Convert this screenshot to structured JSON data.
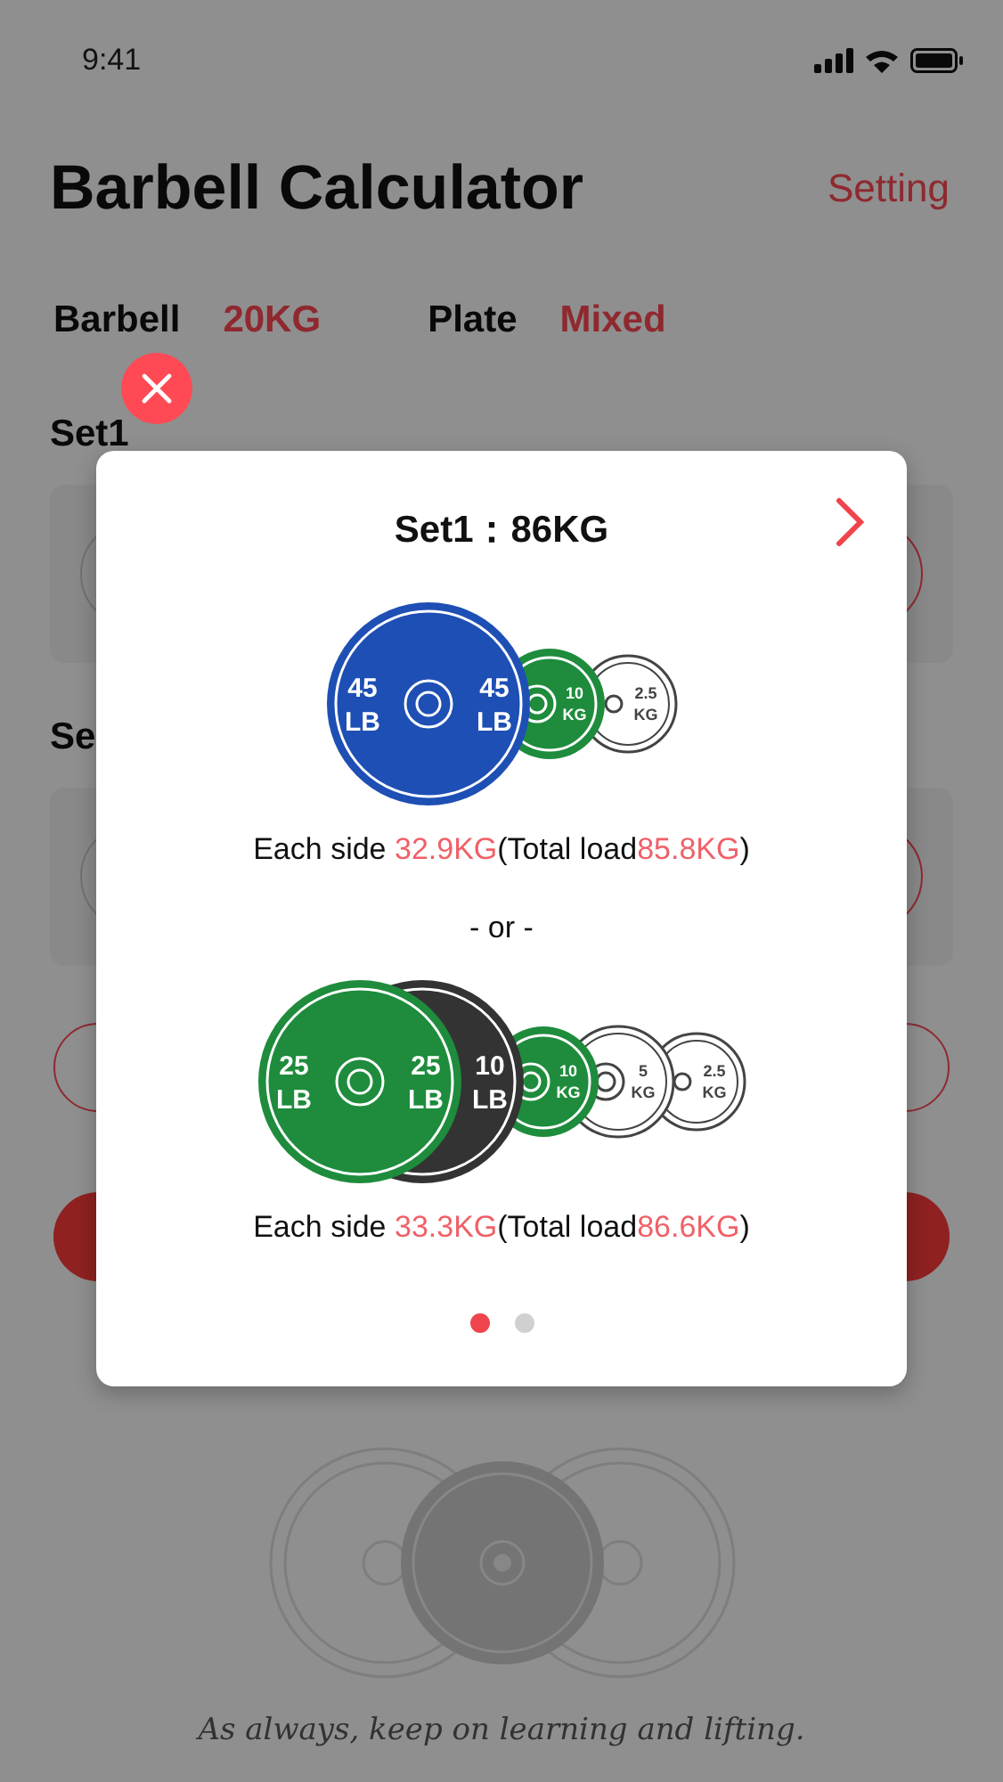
{
  "status_bar": {
    "time": "9:41"
  },
  "header": {
    "title": "Barbell Calculator",
    "action": "Setting"
  },
  "settings": [
    {
      "label": "Barbell",
      "value": "20KG"
    },
    {
      "label": "Plate",
      "value": "Mixed"
    }
  ],
  "sets": [
    {
      "label": "Set1"
    },
    {
      "label": "Se"
    }
  ],
  "tagline": "As always, keep on learning and lifting.",
  "dialog": {
    "title": "Set1：86KG",
    "options": [
      {
        "plates": [
          {
            "kind": "bumper",
            "color": "#1e4fb4",
            "labels": [
              {
                "value": "45",
                "unit": "LB"
              },
              {
                "value": "45",
                "unit": "LB"
              }
            ]
          },
          {
            "kind": "change",
            "color": "#1e8c3c",
            "labels": [
              {
                "value": "10",
                "unit": "KG"
              }
            ]
          },
          {
            "kind": "fractional",
            "color": "#ffffff",
            "labels": [
              {
                "value": "2.5",
                "unit": "KG"
              }
            ]
          }
        ],
        "prefix": "Each side ",
        "each_side": "32.9KG",
        "middle": "(Total load",
        "total": "85.8KG",
        "suffix": ")"
      },
      {
        "plates": [
          {
            "kind": "bumper",
            "color": "#1e8c3c",
            "labels": [
              {
                "value": "25",
                "unit": "LB"
              },
              {
                "value": "25",
                "unit": "LB"
              }
            ]
          },
          {
            "kind": "bumper",
            "color": "#333333",
            "labels": [
              {
                "value": "10",
                "unit": "LB"
              }
            ]
          },
          {
            "kind": "change",
            "color": "#1e8c3c",
            "labels": [
              {
                "value": "10",
                "unit": "KG"
              }
            ]
          },
          {
            "kind": "change",
            "color": "#ffffff",
            "labels": [
              {
                "value": "5",
                "unit": "KG"
              }
            ]
          },
          {
            "kind": "fractional",
            "color": "#ffffff",
            "labels": [
              {
                "value": "2.5",
                "unit": "KG"
              }
            ]
          }
        ],
        "prefix": "Each side ",
        "each_side": "33.3KG",
        "middle": "(Total load",
        "total": "86.6KG",
        "suffix": ")"
      }
    ],
    "separator": "- or -",
    "pages": [
      {
        "selected": true
      },
      {
        "selected": false
      }
    ]
  }
}
